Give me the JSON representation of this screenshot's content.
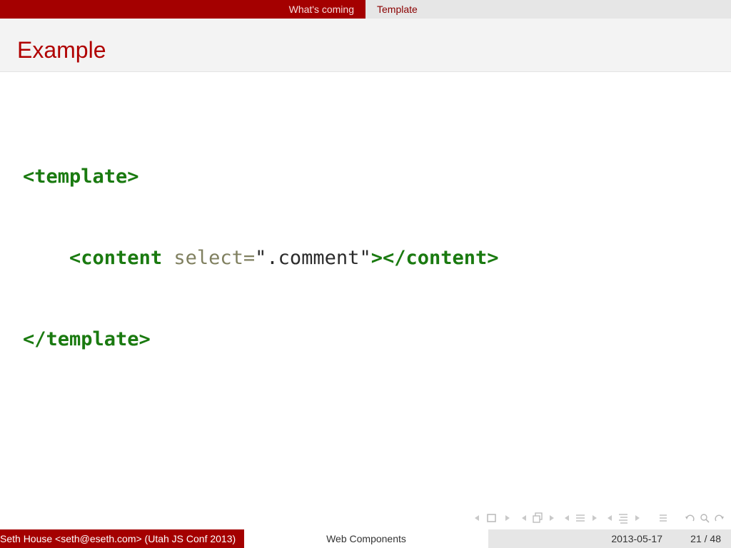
{
  "nav": {
    "sections": [
      "What's coming",
      "Template"
    ],
    "active_section": "Template"
  },
  "frame": {
    "title": "Example",
    "code": {
      "line1": "<template>",
      "line2_tag_open": "<content",
      "line2_attr": "select=",
      "line2_value": "\".comment\"",
      "line2_tag_close": "></content>",
      "line3": "</template>"
    }
  },
  "footer": {
    "author": "Seth House <seth@eseth.com>  (Utah JS Conf 2013)",
    "title": "Web Components",
    "date": "2013-05-17",
    "page": "21 / 48"
  },
  "navigation_symbols": [
    "prev-slide-icon",
    "frame-icon",
    "next-slide-icon",
    "prev-frame-icon",
    "slides-icon",
    "next-frame-icon",
    "prev-subsection-icon",
    "subsection-icon",
    "next-subsection-icon",
    "prev-section-icon",
    "section-icon",
    "next-section-icon",
    "document-icon",
    "undo-icon",
    "search-icon",
    "redo-icon"
  ],
  "colors": {
    "accent": "#a40000",
    "title": "#b00000",
    "code_tag": "#1a7a10",
    "code_attr": "#808060"
  }
}
